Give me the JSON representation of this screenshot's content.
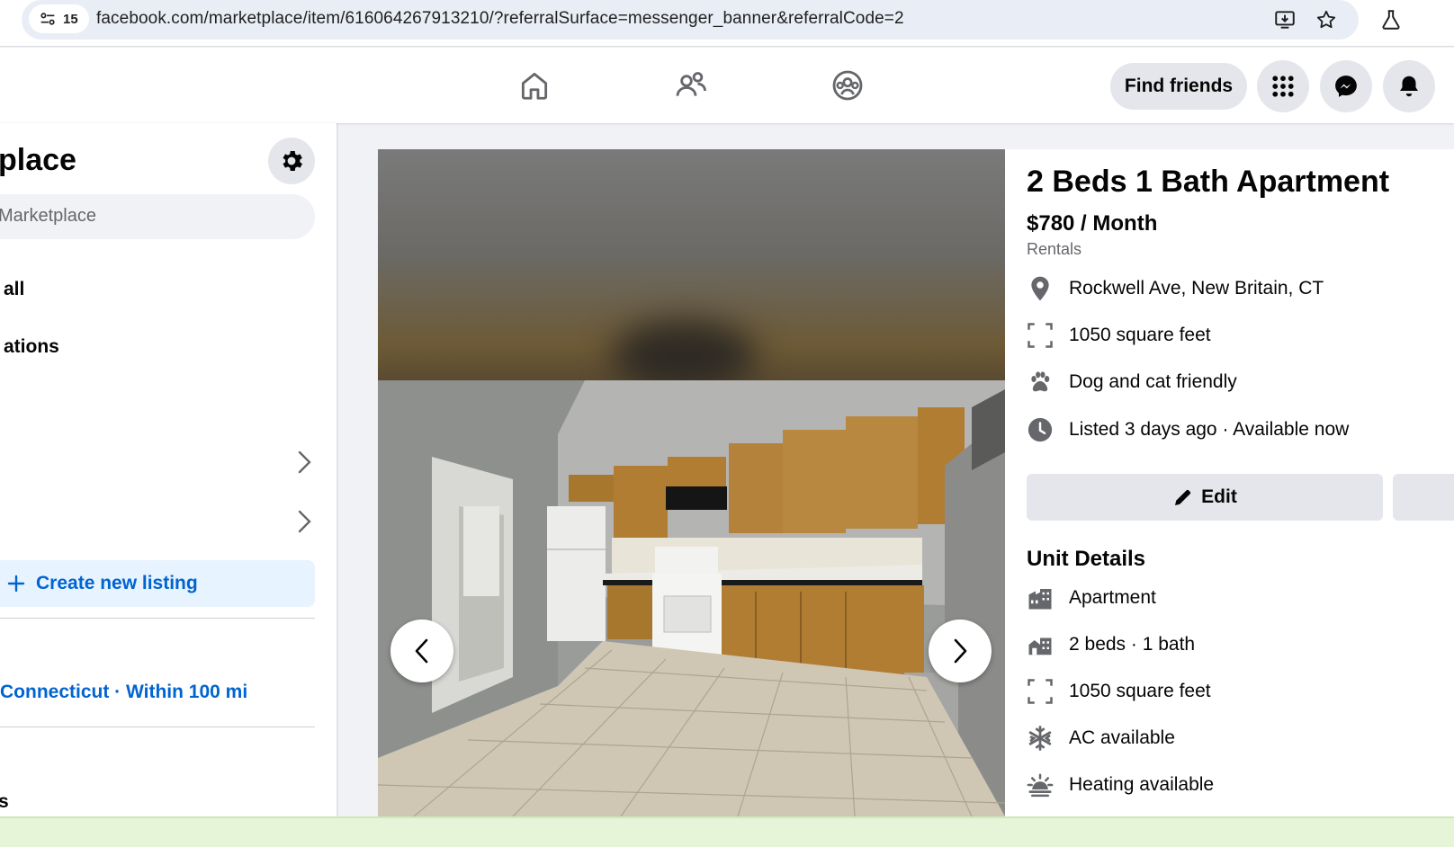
{
  "browser": {
    "tab_count": "15",
    "url": "facebook.com/marketplace/item/616064267913210/?referralSurface=messenger_banner&referralCode=2"
  },
  "top_nav": {
    "find_friends_label": "Find friends"
  },
  "sidebar": {
    "title_partial": "place",
    "search_placeholder": "Marketplace",
    "items": [
      {
        "label": "all"
      },
      {
        "label": "ations"
      }
    ],
    "create_listing_label": "Create new listing",
    "location": "Connecticut · Within 100 mi",
    "bottom_partial": "s"
  },
  "listing": {
    "title": "2 Beds 1 Bath Apartment",
    "price": "$780 / Month",
    "category": "Rentals",
    "facts": [
      {
        "icon": "location-pin-icon",
        "text": "Rockwell Ave, New Britain, CT"
      },
      {
        "icon": "square-feet-icon",
        "text": "1050 square feet"
      },
      {
        "icon": "paw-icon",
        "text": "Dog and cat friendly"
      },
      {
        "icon": "clock-icon",
        "text": "Listed 3 days ago · Available now"
      }
    ],
    "edit_label": "Edit",
    "unit_details_heading": "Unit Details",
    "unit_details": [
      {
        "icon": "building-icon",
        "text": "Apartment"
      },
      {
        "icon": "bed-icon",
        "text": "2 beds · 1 bath"
      },
      {
        "icon": "square-feet-icon",
        "text": "1050 square feet"
      },
      {
        "icon": "snowflake-icon",
        "text": "AC available"
      },
      {
        "icon": "heating-icon",
        "text": "Heating available"
      }
    ]
  },
  "colors": {
    "fb_blue": "#0064d1",
    "light_blue_bg": "#e7f3ff",
    "button_gray": "#e4e6eb",
    "icon_gray": "#65676b"
  }
}
